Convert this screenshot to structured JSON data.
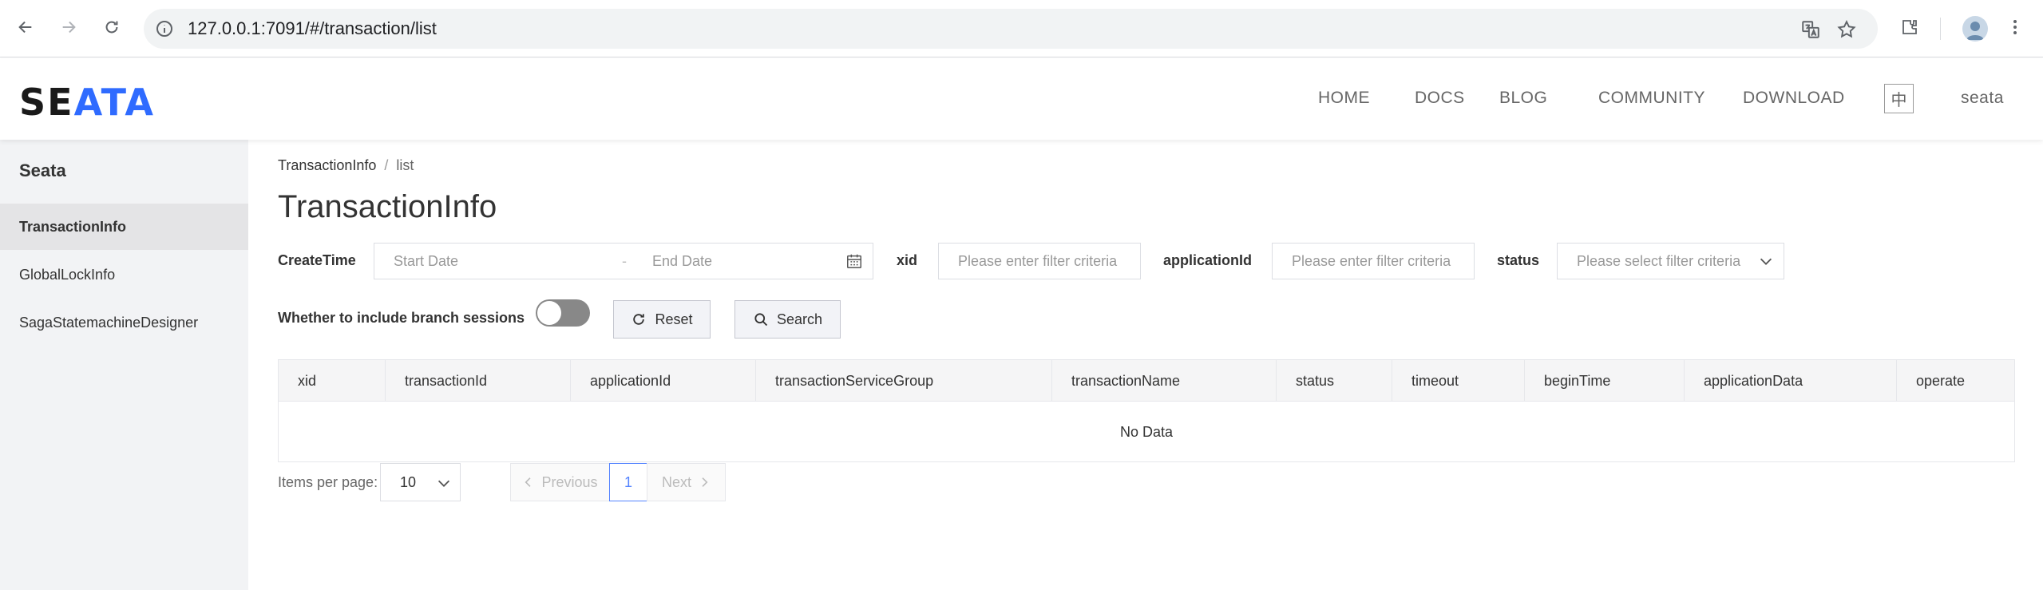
{
  "browser": {
    "url": "127.0.0.1:7091/#/transaction/list"
  },
  "header": {
    "logo": {
      "part1": "SE",
      "part2": "ATA"
    },
    "nav": [
      {
        "label": "HOME"
      },
      {
        "label": "DOCS"
      },
      {
        "label": "BLOG"
      },
      {
        "label": "COMMUNITY"
      },
      {
        "label": "DOWNLOAD"
      }
    ],
    "lang": "中",
    "user": "seata"
  },
  "sidebar": {
    "title": "Seata",
    "items": [
      {
        "label": "TransactionInfo",
        "active": true
      },
      {
        "label": "GlobalLockInfo",
        "active": false
      },
      {
        "label": "SagaStatemachineDesigner",
        "active": false
      }
    ]
  },
  "breadcrumb": {
    "root": "TransactionInfo",
    "separator": "/",
    "current": "list"
  },
  "page_title": "TransactionInfo",
  "filters": {
    "create_time_label": "CreateTime",
    "start_placeholder": "Start Date",
    "range_separator": "-",
    "end_placeholder": "End Date",
    "xid_label": "xid",
    "xid_placeholder": "Please enter filter criteria",
    "app_label": "applicationId",
    "app_placeholder": "Please enter filter criteria",
    "status_label": "status",
    "status_placeholder": "Please select filter criteria",
    "branch_label": "Whether to include branch sessions",
    "branch_on": false,
    "reset_label": "Reset",
    "search_label": "Search"
  },
  "table": {
    "columns": [
      "xid",
      "transactionId",
      "applicationId",
      "transactionServiceGroup",
      "transactionName",
      "status",
      "timeout",
      "beginTime",
      "applicationData",
      "operate"
    ],
    "empty_text": "No Data"
  },
  "pagination": {
    "items_label": "Items per page:",
    "page_size": "10",
    "prev_label": "Previous",
    "current_page": "1",
    "next_label": "Next"
  },
  "colors": {
    "accent": "#5584ff",
    "logo_blue": "#2f6bff",
    "sidebar_bg": "#f2f3f5"
  }
}
